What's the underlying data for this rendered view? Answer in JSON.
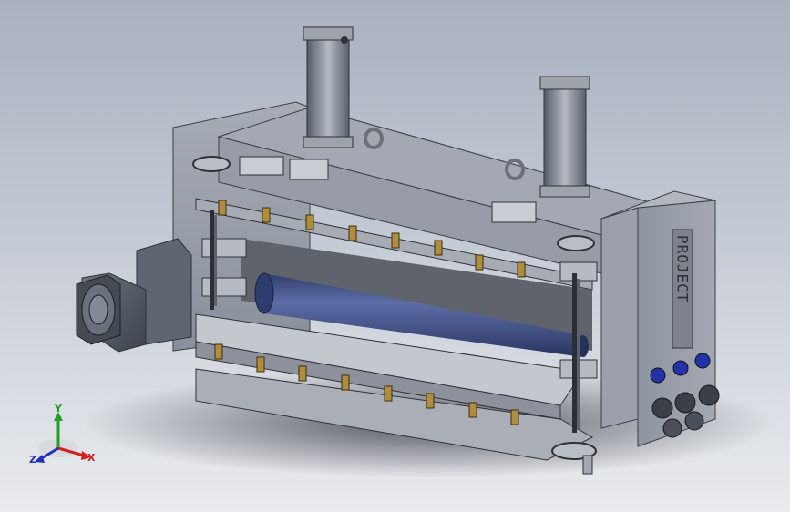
{
  "viewport": {
    "background_top": "#a9b1bf",
    "background_bottom": "#e9ebee"
  },
  "model": {
    "frame_color": "#9aa0ab",
    "roller_color": "#4a5a8e",
    "fitting_color": "#b08d3a",
    "port_color": "#2233aa",
    "side_plate_lettering": "PROJECT"
  },
  "triad": {
    "x_label": "X",
    "y_label": "Y",
    "z_label": "Z",
    "x_color": "#d42020",
    "y_color": "#22a022",
    "z_color": "#2030c0"
  }
}
